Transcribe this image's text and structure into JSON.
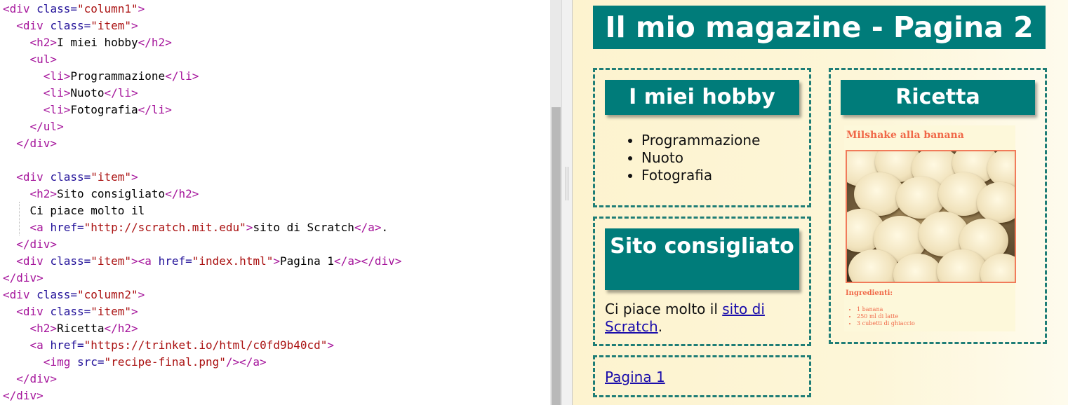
{
  "editor": {
    "lines": [
      [
        [
          "tag",
          "<div "
        ],
        [
          "attr",
          "class="
        ],
        [
          "str",
          "\"column1\""
        ],
        [
          "tag",
          ">"
        ]
      ],
      [
        [
          "txt",
          "  "
        ],
        [
          "tag",
          "<div "
        ],
        [
          "attr",
          "class="
        ],
        [
          "str",
          "\"item\""
        ],
        [
          "tag",
          ">"
        ]
      ],
      [
        [
          "txt",
          "    "
        ],
        [
          "tag",
          "<h2>"
        ],
        [
          "txt",
          "I miei hobby"
        ],
        [
          "tag",
          "</h2>"
        ]
      ],
      [
        [
          "txt",
          "    "
        ],
        [
          "tag",
          "<ul>"
        ]
      ],
      [
        [
          "txt",
          "      "
        ],
        [
          "tag",
          "<li>"
        ],
        [
          "txt",
          "Programmazione"
        ],
        [
          "tag",
          "</li>"
        ]
      ],
      [
        [
          "txt",
          "      "
        ],
        [
          "tag",
          "<li>"
        ],
        [
          "txt",
          "Nuoto"
        ],
        [
          "tag",
          "</li>"
        ]
      ],
      [
        [
          "txt",
          "      "
        ],
        [
          "tag",
          "<li>"
        ],
        [
          "txt",
          "Fotografia"
        ],
        [
          "tag",
          "</li>"
        ]
      ],
      [
        [
          "txt",
          "    "
        ],
        [
          "tag",
          "</ul>"
        ]
      ],
      [
        [
          "txt",
          "  "
        ],
        [
          "tag",
          "</div>"
        ]
      ],
      [],
      [
        [
          "txt",
          "  "
        ],
        [
          "tag",
          "<div "
        ],
        [
          "attr",
          "class="
        ],
        [
          "str",
          "\"item\""
        ],
        [
          "tag",
          ">"
        ]
      ],
      [
        [
          "txt",
          "    "
        ],
        [
          "tag",
          "<h2>"
        ],
        [
          "txt",
          "Sito consigliato"
        ],
        [
          "tag",
          "</h2>"
        ]
      ],
      [
        [
          "txt",
          "    Ci piace molto il"
        ]
      ],
      [
        [
          "txt",
          "    "
        ],
        [
          "tag",
          "<a "
        ],
        [
          "attr",
          "href="
        ],
        [
          "str",
          "\"http://scratch.mit.edu\""
        ],
        [
          "tag",
          ">"
        ],
        [
          "txt",
          "sito di Scratch"
        ],
        [
          "tag",
          "</a>"
        ],
        [
          "txt",
          "."
        ]
      ],
      [
        [
          "txt",
          "  "
        ],
        [
          "tag",
          "</div>"
        ]
      ],
      [
        [
          "txt",
          "  "
        ],
        [
          "tag",
          "<div "
        ],
        [
          "attr",
          "class="
        ],
        [
          "str",
          "\"item\""
        ],
        [
          "tag",
          ">"
        ],
        [
          "tag",
          "<a "
        ],
        [
          "attr",
          "href="
        ],
        [
          "str",
          "\"index.html\""
        ],
        [
          "tag",
          ">"
        ],
        [
          "txt",
          "Pagina 1"
        ],
        [
          "tag",
          "</a>"
        ],
        [
          "tag",
          "</div>"
        ]
      ],
      [
        [
          "tag",
          "</div>"
        ]
      ],
      [
        [
          "tag",
          "<div "
        ],
        [
          "attr",
          "class="
        ],
        [
          "str",
          "\"column2\""
        ],
        [
          "tag",
          ">"
        ]
      ],
      [
        [
          "txt",
          "  "
        ],
        [
          "tag",
          "<div "
        ],
        [
          "attr",
          "class="
        ],
        [
          "str",
          "\"item\""
        ],
        [
          "tag",
          ">"
        ]
      ],
      [
        [
          "txt",
          "    "
        ],
        [
          "tag",
          "<h2>"
        ],
        [
          "txt",
          "Ricetta"
        ],
        [
          "tag",
          "</h2>"
        ]
      ],
      [
        [
          "txt",
          "    "
        ],
        [
          "tag",
          "<a "
        ],
        [
          "attr",
          "href="
        ],
        [
          "str",
          "\"https://trinket.io/html/c0fd9b40cd\""
        ],
        [
          "tag",
          ">"
        ]
      ],
      [
        [
          "txt",
          "      "
        ],
        [
          "tag",
          "<img "
        ],
        [
          "attr",
          "src="
        ],
        [
          "str",
          "\"recipe-final.png\""
        ],
        [
          "tag",
          "/>"
        ],
        [
          "tag",
          "</a>"
        ]
      ],
      [
        [
          "txt",
          "  "
        ],
        [
          "tag",
          "</div>"
        ]
      ],
      [
        [
          "tag",
          "</div>"
        ]
      ]
    ]
  },
  "preview": {
    "title": "Il mio magazine - Pagina 2",
    "hobby": {
      "heading": "I miei hobby",
      "items": [
        "Programmazione",
        "Nuoto",
        "Fotografia"
      ]
    },
    "site": {
      "heading": "Sito consigliato",
      "text": "Ci piace molto il ",
      "link": "sito di Scratch",
      "suffix": "."
    },
    "page_link": "Pagina 1",
    "recipe": {
      "heading": "Ricetta",
      "card_title": "Milshake alla banana",
      "ingredients_title": "Ingredienti:",
      "ingredients": [
        "1 banana",
        "250 ml di latte",
        "3 cubetti di ghiaccio"
      ]
    }
  },
  "colors": {
    "header_bg": "#007c7a",
    "border": "#1e7d76",
    "tag": "#a5149b",
    "attr": "#221199",
    "string": "#aa1111",
    "recipe_text": "#f06848",
    "link": "#1a0dab"
  }
}
